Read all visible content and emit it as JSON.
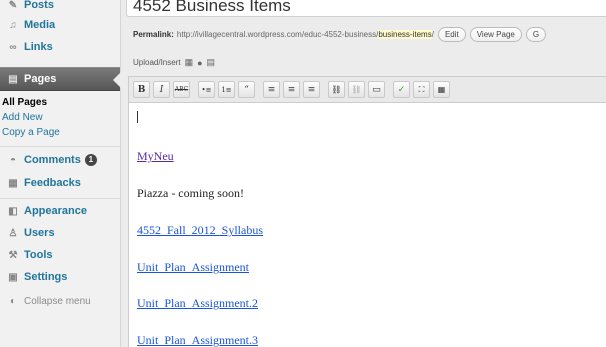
{
  "sidebar": {
    "items": [
      {
        "label": "Posts",
        "icon": "pin-icon",
        "glyph": "✎"
      },
      {
        "label": "Media",
        "icon": "media-icon",
        "glyph": "♫"
      },
      {
        "label": "Links",
        "icon": "link-icon",
        "glyph": "∞"
      },
      {
        "label": "Pages",
        "icon": "pages-icon",
        "glyph": "▤"
      }
    ],
    "subitems": [
      "All Pages",
      "Add New",
      "Copy a Page"
    ],
    "items2": [
      {
        "label": "Comments",
        "icon": "comment-icon",
        "glyph": "◓",
        "badge": "1"
      },
      {
        "label": "Feedbacks",
        "icon": "feedback-icon",
        "glyph": "▦"
      },
      {
        "label": "Appearance",
        "icon": "appearance-icon",
        "glyph": "◧"
      },
      {
        "label": "Users",
        "icon": "users-icon",
        "glyph": "♙"
      },
      {
        "label": "Tools",
        "icon": "tools-icon",
        "glyph": "⚒"
      },
      {
        "label": "Settings",
        "icon": "settings-icon",
        "glyph": "▣"
      }
    ],
    "collapse": "Collapse menu"
  },
  "post": {
    "title": "4552 Business Items",
    "permalink_label": "Permalink:",
    "permalink_base": "http://ivillagecentral.wordpress.com/educ-4552-business/",
    "permalink_slug": "business-items",
    "permalink_end": "/",
    "buttons": [
      "Edit",
      "View Page",
      "G"
    ]
  },
  "upload": {
    "label": "Upload/Insert"
  },
  "toolbar": [
    "B",
    "I",
    "ABC",
    "•≡",
    "1≡",
    "“",
    "≡",
    "≡",
    "≡",
    "⛓",
    "⛓",
    "▭",
    "✓",
    "⛶",
    "▦"
  ],
  "editor": {
    "lines": [
      {
        "text": "MyNeu",
        "type": "visited"
      },
      {
        "text": "Piazza - coming soon!",
        "type": "plain"
      },
      {
        "text": "4552_Fall_2012_Syllabus",
        "type": "link"
      },
      {
        "text": "Unit_Plan_Assignment",
        "type": "link"
      },
      {
        "text": "Unit_Plan_Assignment.2",
        "type": "link"
      },
      {
        "text": "Unit_Plan_Assignment.3",
        "type": "link"
      }
    ]
  }
}
